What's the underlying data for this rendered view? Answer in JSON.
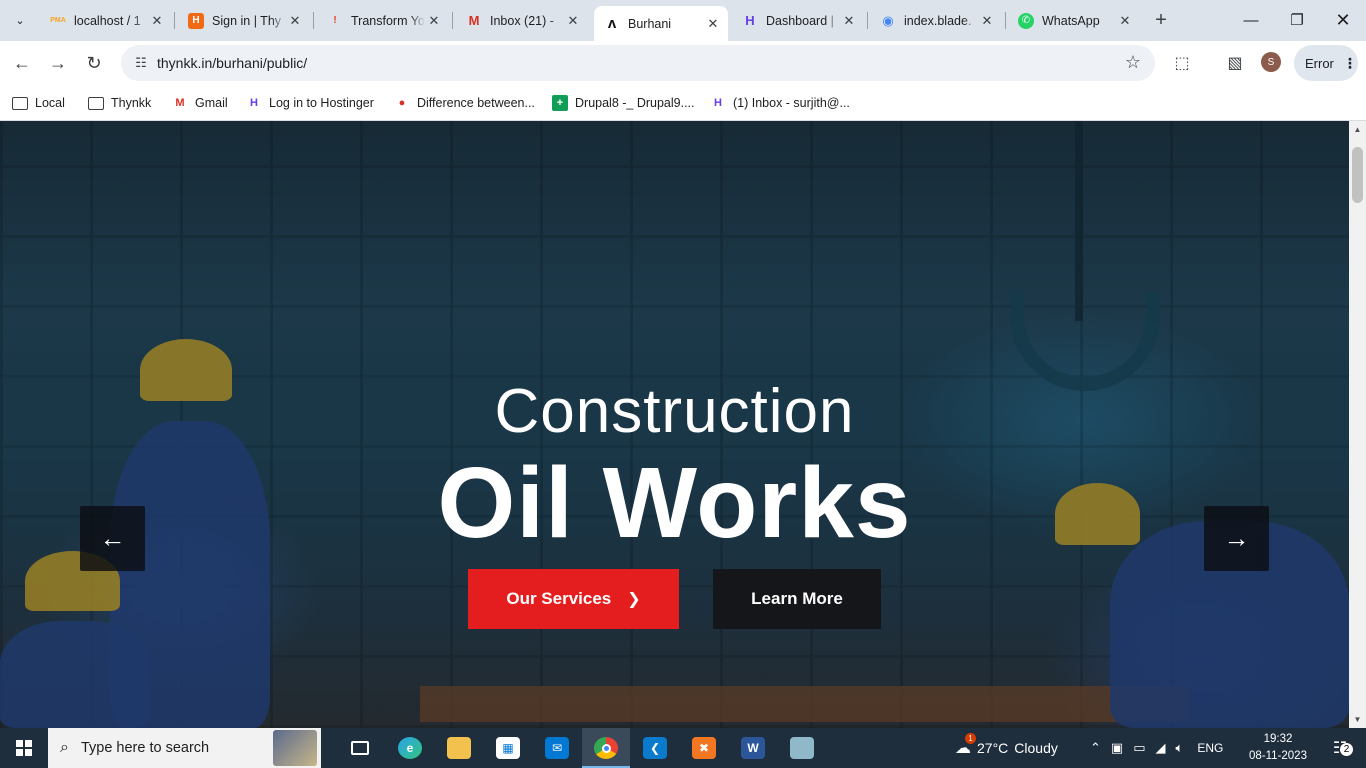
{
  "tabs": [
    {
      "title": "localhost / 1",
      "icon": "phpmyadmin-icon",
      "fav": "PMA",
      "fav_color": "#f5a623"
    },
    {
      "title": "Sign in | Thy",
      "icon": "hostinger-orange-icon",
      "fav": "H",
      "fav_color": "#f06a16"
    },
    {
      "title": "Transform Yo",
      "icon": "transform-icon",
      "fav": "!",
      "fav_color": "#e8442b"
    },
    {
      "title": "Inbox (21) -",
      "icon": "gmail-icon",
      "fav": "M",
      "fav_color": "#d93025"
    },
    {
      "title": "Burhani",
      "icon": "burhani-logo-icon",
      "fav": "A",
      "fav_color": "#111111"
    },
    {
      "title": "Dashboard |",
      "icon": "hostinger-icon",
      "fav": "H",
      "fav_color": "#673de6"
    },
    {
      "title": "index.blade.",
      "icon": "blade-file-icon",
      "fav": "◉",
      "fav_color": "#4285f4"
    },
    {
      "title": "WhatsApp",
      "icon": "whatsapp-icon",
      "fav": "✆",
      "fav_color": "#25d366"
    }
  ],
  "toolbar": {
    "url": "thynkk.in/burhani/public/",
    "profile_initial": "S",
    "error_label": "Error"
  },
  "bookmarks": [
    {
      "label": "Local",
      "icon": "folder-icon"
    },
    {
      "label": "Thynkk",
      "icon": "folder-icon"
    },
    {
      "label": "Gmail",
      "icon": "gmail-icon"
    },
    {
      "label": "Log in to Hostinger",
      "icon": "hostinger-icon"
    },
    {
      "label": "Difference between...",
      "icon": "bookmark-site-icon"
    },
    {
      "label": "Drupal8 -_ Drupal9....",
      "icon": "sheets-icon"
    },
    {
      "label": "(1) Inbox - surjith@...",
      "icon": "hostinger-icon"
    }
  ],
  "hero": {
    "subtitle": "Construction",
    "title": "Oil Works",
    "primary_button": "Our Services",
    "secondary_button": "Learn More"
  },
  "taskbar": {
    "search_placeholder": "Type here to search",
    "weather_temp": "27°C",
    "weather_desc": "Cloudy",
    "weather_badge": "1",
    "language": "ENG",
    "time": "19:32",
    "date": "08-11-2023",
    "notification_count": "2"
  },
  "colors": {
    "accent_red": "#e41e1e",
    "dark_button": "#14161a",
    "taskbar_bg": "#1f2e3d"
  }
}
